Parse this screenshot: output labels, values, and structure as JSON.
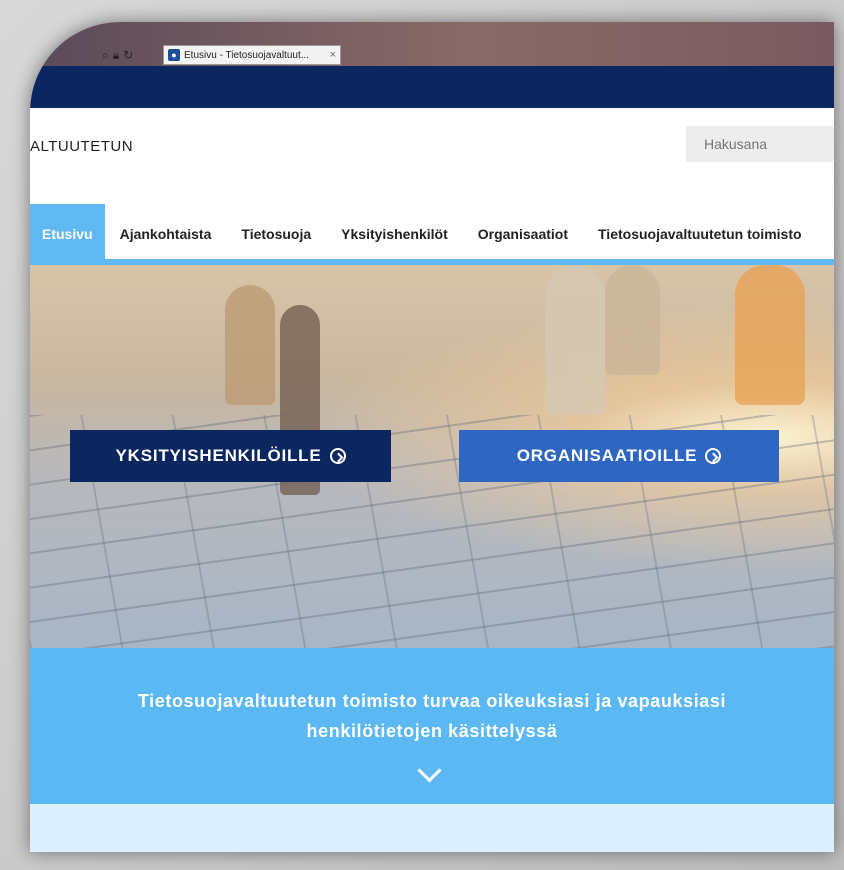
{
  "browser": {
    "tab_title": "Etusivu - Tietosuojavaltuut...",
    "tab_close": "×",
    "favicon_icon": "site-favicon-icon",
    "tools": [
      "search-icon",
      "lock-icon",
      "refresh-icon"
    ]
  },
  "header": {
    "logo_text": "ALTUUTETUN",
    "search_placeholder": "Hakusana"
  },
  "nav": {
    "items": [
      {
        "label": "Etusivu",
        "active": true
      },
      {
        "label": "Ajankohtaista",
        "active": false
      },
      {
        "label": "Tietosuoja",
        "active": false
      },
      {
        "label": "Yksityishenkilöt",
        "active": false
      },
      {
        "label": "Organisaatiot",
        "active": false
      },
      {
        "label": "Tietosuojavaltuutetun toimisto",
        "active": false
      }
    ]
  },
  "hero": {
    "cta_individuals": "YKSITYISHENKILÖILLE",
    "cta_organizations": "ORGANISAATIOILLE"
  },
  "banner": {
    "line1": "Tietosuojavaltuutetun toimisto turvaa oikeuksiasi ja vapauksiasi",
    "line2": "henkilötietojen käsittelyssä"
  },
  "colors": {
    "navy": "#0c2660",
    "light_blue": "#60b9f2",
    "blue": "#2f66c2"
  }
}
